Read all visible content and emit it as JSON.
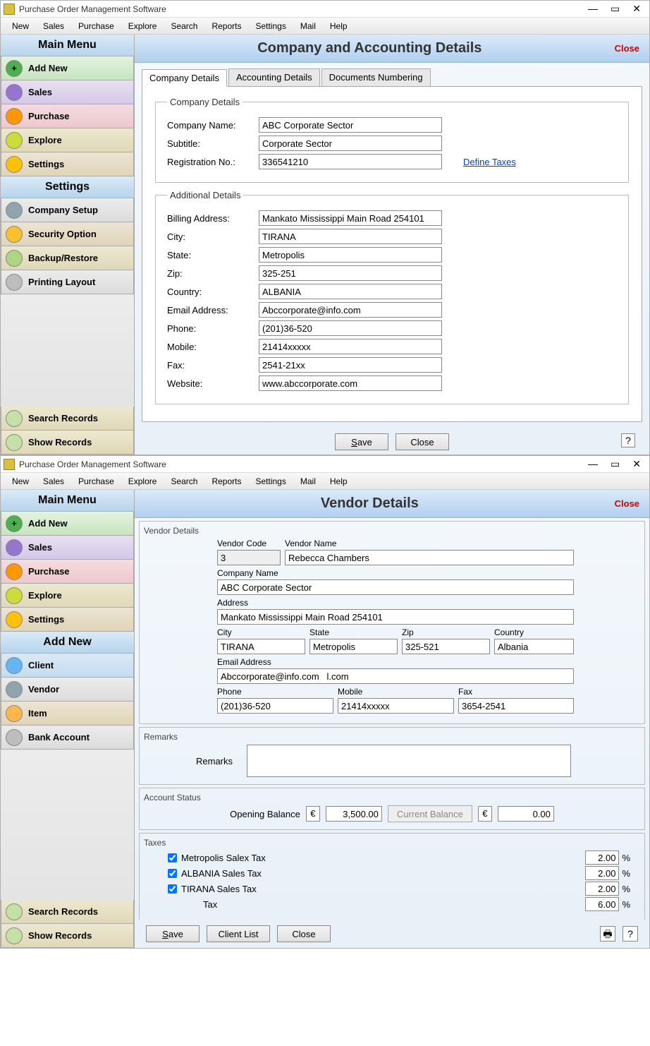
{
  "app": {
    "title": "Purchase Order Management Software"
  },
  "menubar": [
    "New",
    "Sales",
    "Purchase",
    "Explore",
    "Search",
    "Reports",
    "Settings",
    "Mail",
    "Help"
  ],
  "win1": {
    "sidebar": {
      "header1": "Main Menu",
      "items1": [
        "Add New",
        "Sales",
        "Purchase",
        "Explore",
        "Settings"
      ],
      "header2": "Settings",
      "items2": [
        "Company Setup",
        "Security Option",
        "Backup/Restore",
        "Printing Layout"
      ],
      "bottom": [
        "Search Records",
        "Show Records"
      ]
    },
    "title": "Company and Accounting Details",
    "close": "Close",
    "tabs": [
      "Company Details",
      "Accounting Details",
      "Documents Numbering"
    ],
    "fs1": {
      "legend": "Company Details",
      "company_name_label": "Company Name:",
      "company_name": "ABC Corporate Sector",
      "subtitle_label": "Subtitle:",
      "subtitle": "Corporate Sector",
      "reg_no_label": "Registration No.:",
      "reg_no": "336541210",
      "define_taxes": "Define Taxes"
    },
    "fs2": {
      "legend": "Additional Details",
      "billing_label": "Billing Address:",
      "billing": "Mankato Mississippi Main Road 254101",
      "city_label": "City:",
      "city": "TIRANA",
      "state_label": "State:",
      "state": "Metropolis",
      "zip_label": "Zip:",
      "zip": "325-251",
      "country_label": "Country:",
      "country": "ALBANIA",
      "email_label": "Email Address:",
      "email": "Abccorporate@info.com",
      "phone_label": "Phone:",
      "phone": "(201)36-520",
      "mobile_label": "Mobile:",
      "mobile": "21414xxxxx",
      "fax_label": "Fax:",
      "fax": "2541-21xx",
      "website_label": "Website:",
      "website": "www.abccorporate.com"
    },
    "save": "Save",
    "close_btn": "Close"
  },
  "win2": {
    "sidebar": {
      "header1": "Main Menu",
      "items1": [
        "Add New",
        "Sales",
        "Purchase",
        "Explore",
        "Settings"
      ],
      "header2": "Add New",
      "items2": [
        "Client",
        "Vendor",
        "Item",
        "Bank Account"
      ],
      "bottom": [
        "Search Records",
        "Show Records"
      ]
    },
    "title": "Vendor Details",
    "close": "Close",
    "group_title": "Vendor Details",
    "vendor_code_label": "Vendor Code",
    "vendor_code": "3",
    "vendor_name_label": "Vendor Name",
    "vendor_name": "Rebecca Chambers",
    "company_name_label": "Company Name",
    "company_name": "ABC Corporate Sector",
    "address_label": "Address",
    "address": "Mankato Mississippi Main Road 254101",
    "city_label": "City",
    "city": "TIRANA",
    "state_label": "State",
    "state": "Metropolis",
    "zip_label": "Zip",
    "zip": "325-521",
    "country_label": "Country",
    "country": "Albania",
    "email_label": "Email Address",
    "email": "Abccorporate@info.com   l.com",
    "phone_label": "Phone",
    "phone": "(201)36-520",
    "mobile_label": "Mobile",
    "mobile": "21414xxxxx",
    "fax_label": "Fax",
    "fax": "3654-2541",
    "remarks_title": "Remarks",
    "remarks_label": "Remarks",
    "remarks": "",
    "as_title": "Account Status",
    "opening_label": "Opening Balance",
    "opening_sym": "€",
    "opening_val": "3,500.00",
    "current_label": "Current Balance",
    "current_sym": "€",
    "current_val": "0.00",
    "taxes_title": "Taxes",
    "taxes": [
      {
        "label": "Metropolis Salex Tax",
        "val": "2.00"
      },
      {
        "label": "ALBANIA Sales Tax",
        "val": "2.00"
      },
      {
        "label": "TIRANA Sales Tax",
        "val": "2.00"
      }
    ],
    "tax_total_label": "Tax",
    "tax_total": "6.00",
    "save": "Save",
    "client_list": "Client List",
    "close_btn": "Close"
  }
}
